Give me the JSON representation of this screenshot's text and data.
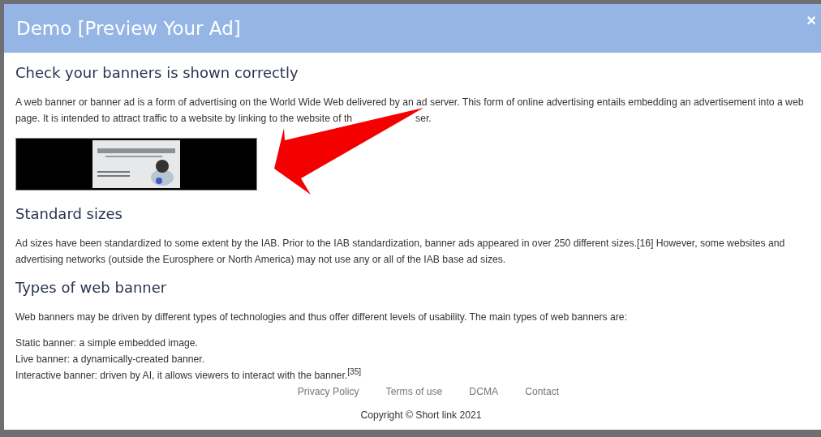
{
  "modal": {
    "title": "Demo [Preview Your Ad]",
    "close": "×"
  },
  "sections": [
    {
      "heading": "Check your banners is shown correctly",
      "annotated_paragraph": {
        "before": "A web banner or banner ad is a form of advertising on the World Wide Web delivered by an ad server. This form of online advertising entails embedding an advertisement into a web page. It is intended to attract traffic to a website by linking to the website of th",
        "after": "ser.",
        "annotation": {
          "kind": "arrow"
        }
      }
    },
    {
      "heading": "Standard sizes",
      "paragraphs": [
        "Ad sizes have been standardized to some extent by the IAB. Prior to the IAB standardization, banner ads appeared in over 250 different sizes.[16] However, some websites and advertising networks (outside the Eurosphere or North America) may not use any or all of the IAB base ad sizes."
      ]
    },
    {
      "heading": "Types of web banner",
      "paragraphs": [
        "Web banners may be driven by different types of technologies and thus offer different levels of usability. The main types of web banners are:"
      ],
      "lines": [
        "Static banner: a simple embedded image.",
        "Live banner: a dynamically-created banner.",
        "Interactive banner: driven by AI, it allows viewers to interact with the banner.$^{[35]}$"
      ]
    }
  ],
  "footer": {
    "links": [
      "Privacy Policy",
      "Terms of use",
      "DCMA",
      "Contact"
    ],
    "copyright": "Copyright © Short link 2021"
  }
}
